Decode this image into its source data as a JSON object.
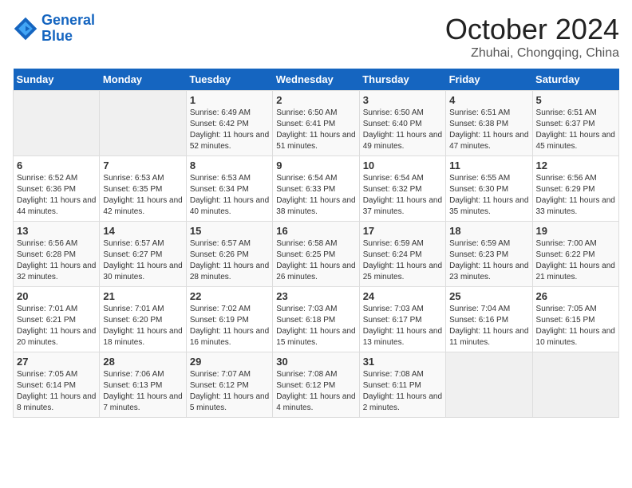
{
  "header": {
    "logo_line1": "General",
    "logo_line2": "Blue",
    "month": "October 2024",
    "location": "Zhuhai, Chongqing, China"
  },
  "days_of_week": [
    "Sunday",
    "Monday",
    "Tuesday",
    "Wednesday",
    "Thursday",
    "Friday",
    "Saturday"
  ],
  "weeks": [
    [
      {
        "day": "",
        "content": ""
      },
      {
        "day": "",
        "content": ""
      },
      {
        "day": "1",
        "content": "Sunrise: 6:49 AM\nSunset: 6:42 PM\nDaylight: 11 hours and 52 minutes."
      },
      {
        "day": "2",
        "content": "Sunrise: 6:50 AM\nSunset: 6:41 PM\nDaylight: 11 hours and 51 minutes."
      },
      {
        "day": "3",
        "content": "Sunrise: 6:50 AM\nSunset: 6:40 PM\nDaylight: 11 hours and 49 minutes."
      },
      {
        "day": "4",
        "content": "Sunrise: 6:51 AM\nSunset: 6:38 PM\nDaylight: 11 hours and 47 minutes."
      },
      {
        "day": "5",
        "content": "Sunrise: 6:51 AM\nSunset: 6:37 PM\nDaylight: 11 hours and 45 minutes."
      }
    ],
    [
      {
        "day": "6",
        "content": "Sunrise: 6:52 AM\nSunset: 6:36 PM\nDaylight: 11 hours and 44 minutes."
      },
      {
        "day": "7",
        "content": "Sunrise: 6:53 AM\nSunset: 6:35 PM\nDaylight: 11 hours and 42 minutes."
      },
      {
        "day": "8",
        "content": "Sunrise: 6:53 AM\nSunset: 6:34 PM\nDaylight: 11 hours and 40 minutes."
      },
      {
        "day": "9",
        "content": "Sunrise: 6:54 AM\nSunset: 6:33 PM\nDaylight: 11 hours and 38 minutes."
      },
      {
        "day": "10",
        "content": "Sunrise: 6:54 AM\nSunset: 6:32 PM\nDaylight: 11 hours and 37 minutes."
      },
      {
        "day": "11",
        "content": "Sunrise: 6:55 AM\nSunset: 6:30 PM\nDaylight: 11 hours and 35 minutes."
      },
      {
        "day": "12",
        "content": "Sunrise: 6:56 AM\nSunset: 6:29 PM\nDaylight: 11 hours and 33 minutes."
      }
    ],
    [
      {
        "day": "13",
        "content": "Sunrise: 6:56 AM\nSunset: 6:28 PM\nDaylight: 11 hours and 32 minutes."
      },
      {
        "day": "14",
        "content": "Sunrise: 6:57 AM\nSunset: 6:27 PM\nDaylight: 11 hours and 30 minutes."
      },
      {
        "day": "15",
        "content": "Sunrise: 6:57 AM\nSunset: 6:26 PM\nDaylight: 11 hours and 28 minutes."
      },
      {
        "day": "16",
        "content": "Sunrise: 6:58 AM\nSunset: 6:25 PM\nDaylight: 11 hours and 26 minutes."
      },
      {
        "day": "17",
        "content": "Sunrise: 6:59 AM\nSunset: 6:24 PM\nDaylight: 11 hours and 25 minutes."
      },
      {
        "day": "18",
        "content": "Sunrise: 6:59 AM\nSunset: 6:23 PM\nDaylight: 11 hours and 23 minutes."
      },
      {
        "day": "19",
        "content": "Sunrise: 7:00 AM\nSunset: 6:22 PM\nDaylight: 11 hours and 21 minutes."
      }
    ],
    [
      {
        "day": "20",
        "content": "Sunrise: 7:01 AM\nSunset: 6:21 PM\nDaylight: 11 hours and 20 minutes."
      },
      {
        "day": "21",
        "content": "Sunrise: 7:01 AM\nSunset: 6:20 PM\nDaylight: 11 hours and 18 minutes."
      },
      {
        "day": "22",
        "content": "Sunrise: 7:02 AM\nSunset: 6:19 PM\nDaylight: 11 hours and 16 minutes."
      },
      {
        "day": "23",
        "content": "Sunrise: 7:03 AM\nSunset: 6:18 PM\nDaylight: 11 hours and 15 minutes."
      },
      {
        "day": "24",
        "content": "Sunrise: 7:03 AM\nSunset: 6:17 PM\nDaylight: 11 hours and 13 minutes."
      },
      {
        "day": "25",
        "content": "Sunrise: 7:04 AM\nSunset: 6:16 PM\nDaylight: 11 hours and 11 minutes."
      },
      {
        "day": "26",
        "content": "Sunrise: 7:05 AM\nSunset: 6:15 PM\nDaylight: 11 hours and 10 minutes."
      }
    ],
    [
      {
        "day": "27",
        "content": "Sunrise: 7:05 AM\nSunset: 6:14 PM\nDaylight: 11 hours and 8 minutes."
      },
      {
        "day": "28",
        "content": "Sunrise: 7:06 AM\nSunset: 6:13 PM\nDaylight: 11 hours and 7 minutes."
      },
      {
        "day": "29",
        "content": "Sunrise: 7:07 AM\nSunset: 6:12 PM\nDaylight: 11 hours and 5 minutes."
      },
      {
        "day": "30",
        "content": "Sunrise: 7:08 AM\nSunset: 6:12 PM\nDaylight: 11 hours and 4 minutes."
      },
      {
        "day": "31",
        "content": "Sunrise: 7:08 AM\nSunset: 6:11 PM\nDaylight: 11 hours and 2 minutes."
      },
      {
        "day": "",
        "content": ""
      },
      {
        "day": "",
        "content": ""
      }
    ]
  ]
}
